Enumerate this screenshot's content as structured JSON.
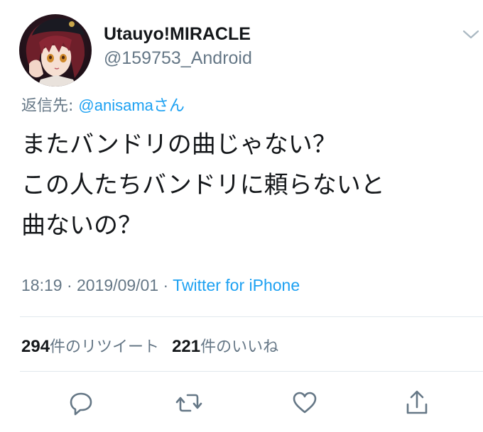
{
  "user": {
    "name": "Utauyo!MIRACLE",
    "handle": "@159753_Android"
  },
  "reply": {
    "prefix": "返信先: ",
    "user": "@anisama",
    "suffix": "さん"
  },
  "tweet": {
    "text": "またバンドリの曲じゃない？\nこの人たちバンドリに頼らないと\n曲ないの？"
  },
  "meta": {
    "time": "18:19",
    "separator": " · ",
    "date": "2019/09/01",
    "source": "Twitter for iPhone"
  },
  "stats": {
    "retweets_count": "294",
    "retweets_label": "件のリツイート",
    "likes_count": "221",
    "likes_label": "件のいいね"
  },
  "icons": {
    "menu": "chevron-down-icon",
    "reply": "reply-icon",
    "retweet": "retweet-icon",
    "like": "heart-icon",
    "share": "share-icon"
  },
  "colors": {
    "link": "#1da1f2",
    "secondary_text": "#657786",
    "primary_text": "#14171a",
    "divider": "#e1e8ed"
  }
}
